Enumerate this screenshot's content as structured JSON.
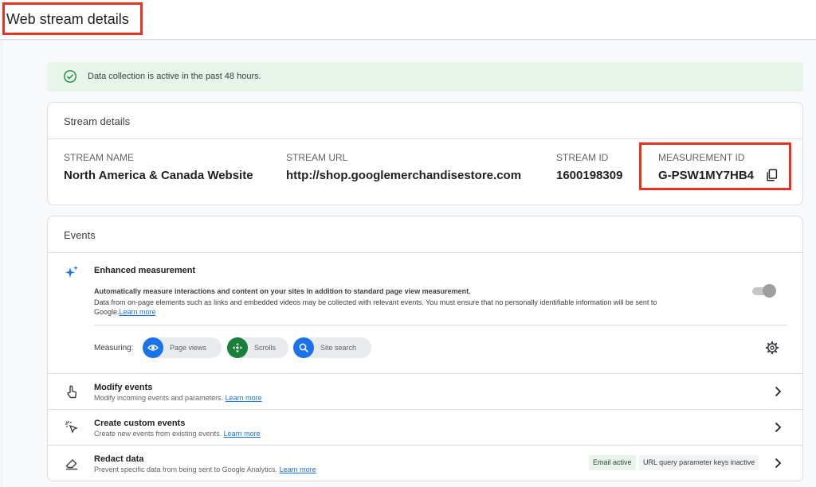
{
  "page": {
    "title": "Web stream details"
  },
  "banner": {
    "text": "Data collection is active in the past 48 hours.",
    "icon": "check-circle-icon",
    "color": "#1e8e3e"
  },
  "stream_details": {
    "heading": "Stream details",
    "fields": [
      {
        "label": "STREAM NAME",
        "value": "North America & Canada Website"
      },
      {
        "label": "STREAM URL",
        "value": "http://shop.googlemerchandisestore.com"
      },
      {
        "label": "STREAM ID",
        "value": "1600198309"
      },
      {
        "label": "MEASUREMENT ID",
        "value": "G-PSW1MY7HB4"
      }
    ],
    "copy_icon": "copy-icon"
  },
  "events": {
    "heading": "Events",
    "enhanced": {
      "title": "Enhanced measurement",
      "line1": "Automatically measure interactions and content on your sites in addition to standard page view measurement.",
      "line2": "Data from on-page elements such as links and embedded videos may be collected with relevant events. You must ensure that no personally identifiable information will be sent to",
      "line3": "Google.",
      "learn_more": "Learn more",
      "toggle_on": true
    },
    "measuring": {
      "label": "Measuring:",
      "chips": [
        {
          "label": "Page views",
          "icon": "eye-icon",
          "color": "#1a73e8"
        },
        {
          "label": "Scrolls",
          "icon": "move-icon",
          "color": "#188038"
        },
        {
          "label": "Site search",
          "icon": "search-icon",
          "color": "#1a73e8"
        }
      ]
    },
    "rows": [
      {
        "title": "Modify events",
        "subtitle": "Modify incoming events and parameters.",
        "learn_more": "Learn more",
        "icon": "touch-icon"
      },
      {
        "title": "Create custom events",
        "subtitle": "Create new events from existing events.",
        "learn_more": "Learn more",
        "icon": "click-sparkle-icon"
      },
      {
        "title": "Redact data",
        "subtitle": "Prevent specific data from being sent to Google Analytics.",
        "learn_more": "Learn more",
        "icon": "eraser-icon",
        "badges": [
          "Email active",
          "URL query parameter keys inactive"
        ]
      }
    ]
  },
  "colors": {
    "highlight": "#e8311f",
    "link": "#1a73e8",
    "banner_bg": "#e6f4ea"
  }
}
